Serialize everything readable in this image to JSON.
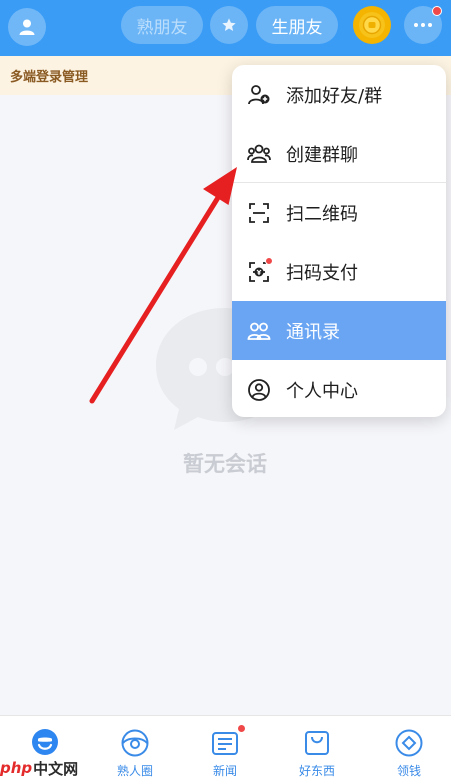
{
  "header": {
    "tab_known": "熟朋友",
    "tab_stranger": "生朋友",
    "icons": {
      "avatar": "user-icon",
      "star": "star-icon",
      "coin": "coin-icon",
      "more": "more-dots-icon"
    }
  },
  "banner": {
    "text": "多端登录管理"
  },
  "empty_state": {
    "text": "暂无会话"
  },
  "menu": {
    "items": [
      {
        "label": "添加好友/群",
        "icon": "add-user-icon"
      },
      {
        "label": "创建群聊",
        "icon": "group-icon"
      },
      {
        "label": "扫二维码",
        "icon": "scan-icon"
      },
      {
        "label": "扫码支付",
        "icon": "scan-pay-icon"
      },
      {
        "label": "通讯录",
        "icon": "contacts-icon"
      },
      {
        "label": "个人中心",
        "icon": "profile-icon"
      }
    ],
    "active_index": 4
  },
  "bottom_nav": {
    "items": [
      {
        "label": "",
        "icon": "chat-icon"
      },
      {
        "label": "熟人圈",
        "icon": "moments-icon"
      },
      {
        "label": "新闻",
        "icon": "news-icon"
      },
      {
        "label": "好东西",
        "icon": "shop-bag-icon"
      },
      {
        "label": "领钱",
        "icon": "money-icon"
      }
    ]
  },
  "watermark": {
    "php": "php",
    "site": "中文网"
  },
  "colors": {
    "primary": "#3a9cf5",
    "menu_active": "#6aa5f3",
    "arrow": "#e62020",
    "banner_bg": "#fdf3e2",
    "nav_blue": "#3a8be8"
  }
}
